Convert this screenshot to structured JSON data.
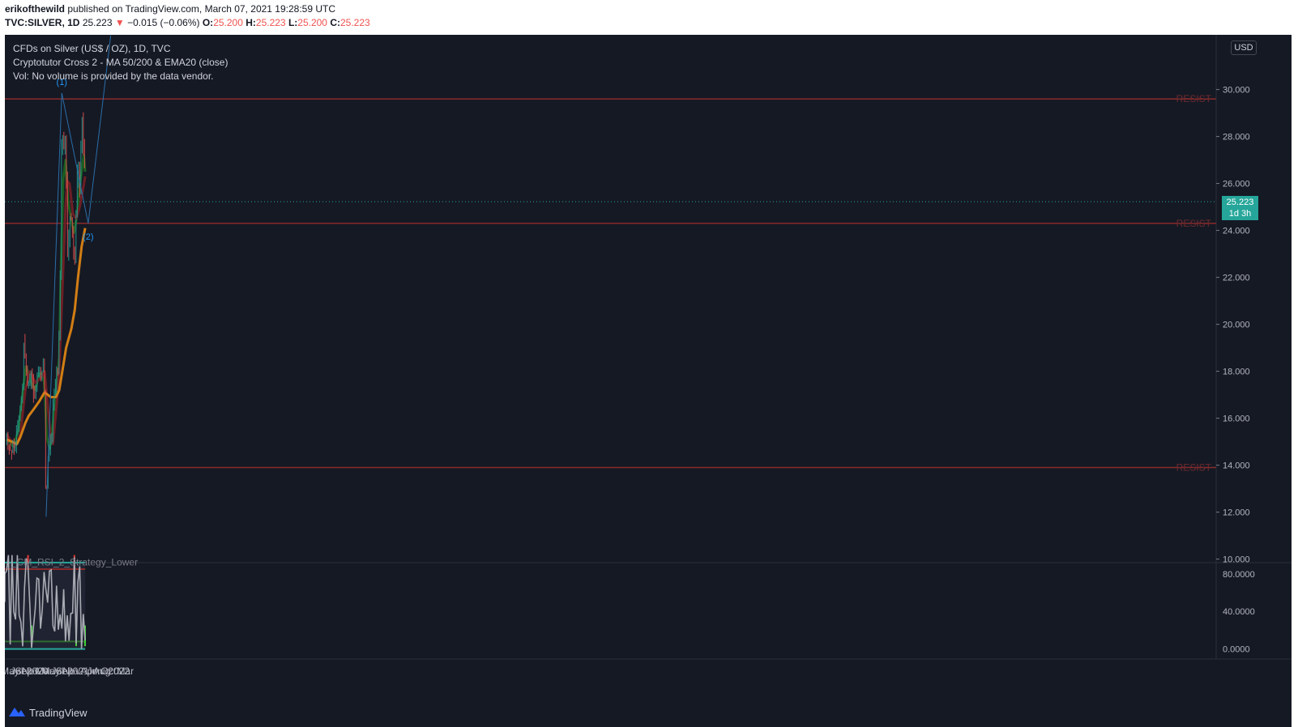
{
  "header": {
    "author": "erikofthewild",
    "published": "published on TradingView.com, March 07, 2021 19:28:59 UTC",
    "symbol": "TVC:SILVER, 1D",
    "last": "25.223",
    "arrow": "▼",
    "change": "−0.015 (−0.06%)",
    "o_label": "O:",
    "o": "25.200",
    "h_label": "H:",
    "h": "25.223",
    "l_label": "L:",
    "l": "25.200",
    "c_label": "C:",
    "c": "25.223"
  },
  "legend": {
    "title": "CFDs on Silver (US$ / OZ), 1D, TVC",
    "indicator": "Cryptotutor Cross 2 - MA 50/200 & EMA20 (close)",
    "volume": "Vol: No volume is provided by the data vendor."
  },
  "price_axis": {
    "currency_button": "USD",
    "current_price": "25.223",
    "countdown": "1d 3h"
  },
  "footer": {
    "brand": "TradingView"
  },
  "colors": {
    "background": "#151924",
    "up": "#26a69a",
    "down": "#ef5350",
    "ema20": "#1b5e20",
    "ma50": "#6d1f24",
    "ma200": "#d27e14",
    "resist": "#8b2a2a",
    "pattern": "#2a6ea8"
  },
  "chart_data": [
    {
      "type": "line",
      "subtype": "candlestick",
      "x_ticks": [
        "May",
        "Jul",
        "Sep",
        "Nov",
        "2020",
        "Mar",
        "May",
        "Jul",
        "Sep",
        "Nov",
        "2021",
        "Apr",
        "Jun",
        "Aug",
        "Oct",
        "2022",
        "Mar"
      ],
      "y_ticks": [
        "10.000",
        "12.000",
        "14.000",
        "16.000",
        "18.000",
        "20.000",
        "22.000",
        "24.000",
        "26.000",
        "28.000",
        "30.000"
      ],
      "ylim": [
        10,
        32
      ],
      "price_path": [
        [
          "2019-04-01",
          15.1
        ],
        [
          "2019-05-15",
          14.6
        ],
        [
          "2019-06-01",
          14.7
        ],
        [
          "2019-07-01",
          15.2
        ],
        [
          "2019-07-25",
          16.4
        ],
        [
          "2019-08-20",
          17.3
        ],
        [
          "2019-09-04",
          19.5
        ],
        [
          "2019-09-25",
          17.8
        ],
        [
          "2019-10-10",
          17.5
        ],
        [
          "2019-11-05",
          17.9
        ],
        [
          "2019-11-25",
          17.1
        ],
        [
          "2019-12-10",
          17.0
        ],
        [
          "2019-12-31",
          17.9
        ],
        [
          "2020-01-10",
          18.2
        ],
        [
          "2020-01-25",
          17.8
        ],
        [
          "2020-02-10",
          17.7
        ],
        [
          "2020-02-24",
          18.6
        ],
        [
          "2020-03-05",
          16.8
        ],
        [
          "2020-03-19",
          11.8
        ],
        [
          "2020-04-01",
          14.0
        ],
        [
          "2020-04-20",
          15.1
        ],
        [
          "2020-05-10",
          15.2
        ],
        [
          "2020-05-20",
          16.8
        ],
        [
          "2020-06-10",
          17.8
        ],
        [
          "2020-06-25",
          17.6
        ],
        [
          "2020-07-10",
          18.5
        ],
        [
          "2020-07-22",
          21.0
        ],
        [
          "2020-07-31",
          24.5
        ],
        [
          "2020-08-07",
          29.0
        ],
        [
          "2020-08-20",
          27.5
        ],
        [
          "2020-09-01",
          28.2
        ],
        [
          "2020-09-15",
          26.8
        ],
        [
          "2020-09-24",
          22.5
        ],
        [
          "2020-10-05",
          23.8
        ],
        [
          "2020-10-20",
          24.6
        ],
        [
          "2020-11-05",
          24.2
        ],
        [
          "2020-11-20",
          23.5
        ],
        [
          "2020-11-30",
          22.5
        ],
        [
          "2020-12-10",
          24.2
        ],
        [
          "2020-12-20",
          25.9
        ],
        [
          "2021-01-05",
          26.7
        ],
        [
          "2021-01-20",
          25.4
        ],
        [
          "2021-02-01",
          29.0
        ],
        [
          "2021-02-15",
          27.5
        ],
        [
          "2021-02-25",
          27.2
        ],
        [
          "2021-03-05",
          25.2
        ]
      ],
      "series": [
        {
          "name": "EMA20",
          "values": [
            [
              "2019-04-01",
              15.1
            ],
            [
              "2019-06-01",
              14.8
            ],
            [
              "2019-07-15",
              15.5
            ],
            [
              "2019-08-20",
              17.0
            ],
            [
              "2019-09-20",
              18.2
            ],
            [
              "2019-11-01",
              17.6
            ],
            [
              "2019-12-10",
              17.2
            ],
            [
              "2020-01-20",
              17.9
            ],
            [
              "2020-02-25",
              17.9
            ],
            [
              "2020-03-10",
              16.9
            ],
            [
              "2020-03-25",
              15.2
            ],
            [
              "2020-04-20",
              14.7
            ],
            [
              "2020-05-20",
              15.8
            ],
            [
              "2020-06-20",
              17.3
            ],
            [
              "2020-07-15",
              18.6
            ],
            [
              "2020-07-31",
              22.5
            ],
            [
              "2020-08-20",
              26.2
            ],
            [
              "2020-09-10",
              27.0
            ],
            [
              "2020-10-01",
              25.3
            ],
            [
              "2020-11-01",
              24.4
            ],
            [
              "2020-11-25",
              23.9
            ],
            [
              "2020-12-20",
              24.6
            ],
            [
              "2021-01-20",
              26.1
            ],
            [
              "2021-02-20",
              27.2
            ],
            [
              "2021-03-05",
              26.5
            ]
          ]
        },
        {
          "name": "MA50",
          "values": [
            [
              "2019-04-01",
              15.3
            ],
            [
              "2019-06-15",
              14.8
            ],
            [
              "2019-08-01",
              15.3
            ],
            [
              "2019-09-15",
              17.2
            ],
            [
              "2019-10-25",
              18.0
            ],
            [
              "2019-12-15",
              17.5
            ],
            [
              "2020-02-15",
              17.8
            ],
            [
              "2020-03-05",
              18.0
            ],
            [
              "2020-04-01",
              16.6
            ],
            [
              "2020-05-01",
              15.1
            ],
            [
              "2020-05-20",
              14.9
            ],
            [
              "2020-06-20",
              16.5
            ],
            [
              "2020-07-15",
              18.0
            ],
            [
              "2020-08-15",
              21.8
            ],
            [
              "2020-09-10",
              25.0
            ],
            [
              "2020-09-25",
              26.1
            ],
            [
              "2020-10-15",
              26.0
            ],
            [
              "2020-11-15",
              24.7
            ],
            [
              "2020-12-15",
              24.5
            ],
            [
              "2021-01-15",
              25.0
            ],
            [
              "2021-02-15",
              25.8
            ],
            [
              "2021-03-05",
              26.3
            ]
          ]
        },
        {
          "name": "MA200",
          "values": [
            [
              "2019-04-01",
              15.1
            ],
            [
              "2019-07-01",
              14.9
            ],
            [
              "2019-08-01",
              15.2
            ],
            [
              "2019-09-15",
              15.8
            ],
            [
              "2019-10-15",
              16.1
            ],
            [
              "2019-12-01",
              16.4
            ],
            [
              "2020-01-15",
              16.7
            ],
            [
              "2020-03-05",
              17.1
            ],
            [
              "2020-05-01",
              16.9
            ],
            [
              "2020-06-15",
              16.9
            ],
            [
              "2020-07-15",
              17.2
            ],
            [
              "2020-08-15",
              18.1
            ],
            [
              "2020-09-15",
              19.0
            ],
            [
              "2020-10-31",
              19.8
            ],
            [
              "2020-12-01",
              20.6
            ],
            [
              "2020-12-31",
              22.0
            ],
            [
              "2021-02-01",
              23.3
            ],
            [
              "2021-03-05",
              24.1
            ]
          ]
        }
      ],
      "horizontal_levels": [
        {
          "label": "RESIST",
          "value": 29.6
        },
        {
          "label": "RESIST",
          "value": 24.3
        },
        {
          "label": "RESIST",
          "value": 13.9
        }
      ],
      "wave_labels": [
        {
          "label": "(1)",
          "x": "2020-08-07",
          "y": 29.85
        },
        {
          "label": "(2)",
          "x": "2021-04-01",
          "y": 24.3
        }
      ],
      "pattern_lines": [
        [
          [
            "2020-03-19",
            11.8
          ],
          [
            "2020-08-07",
            29.85
          ]
        ],
        [
          [
            "2020-08-07",
            29.85
          ],
          [
            "2021-04-01",
            24.3
          ]
        ],
        [
          [
            "2021-04-01",
            24.3
          ],
          [
            "2021-10-20",
            32.3
          ]
        ]
      ],
      "current_price": 25.223
    },
    {
      "type": "line",
      "title": "_CM_RSI_2_Strategy_Lower",
      "y_ticks": [
        "0.0000",
        "40.0000",
        "80.0000"
      ],
      "ylim": [
        -5,
        105
      ],
      "levels": [
        90,
        10,
        0
      ],
      "note": "oscillating RSI(2) values between roughly 0 and 100 from 2019-04 to 2021-03"
    }
  ]
}
